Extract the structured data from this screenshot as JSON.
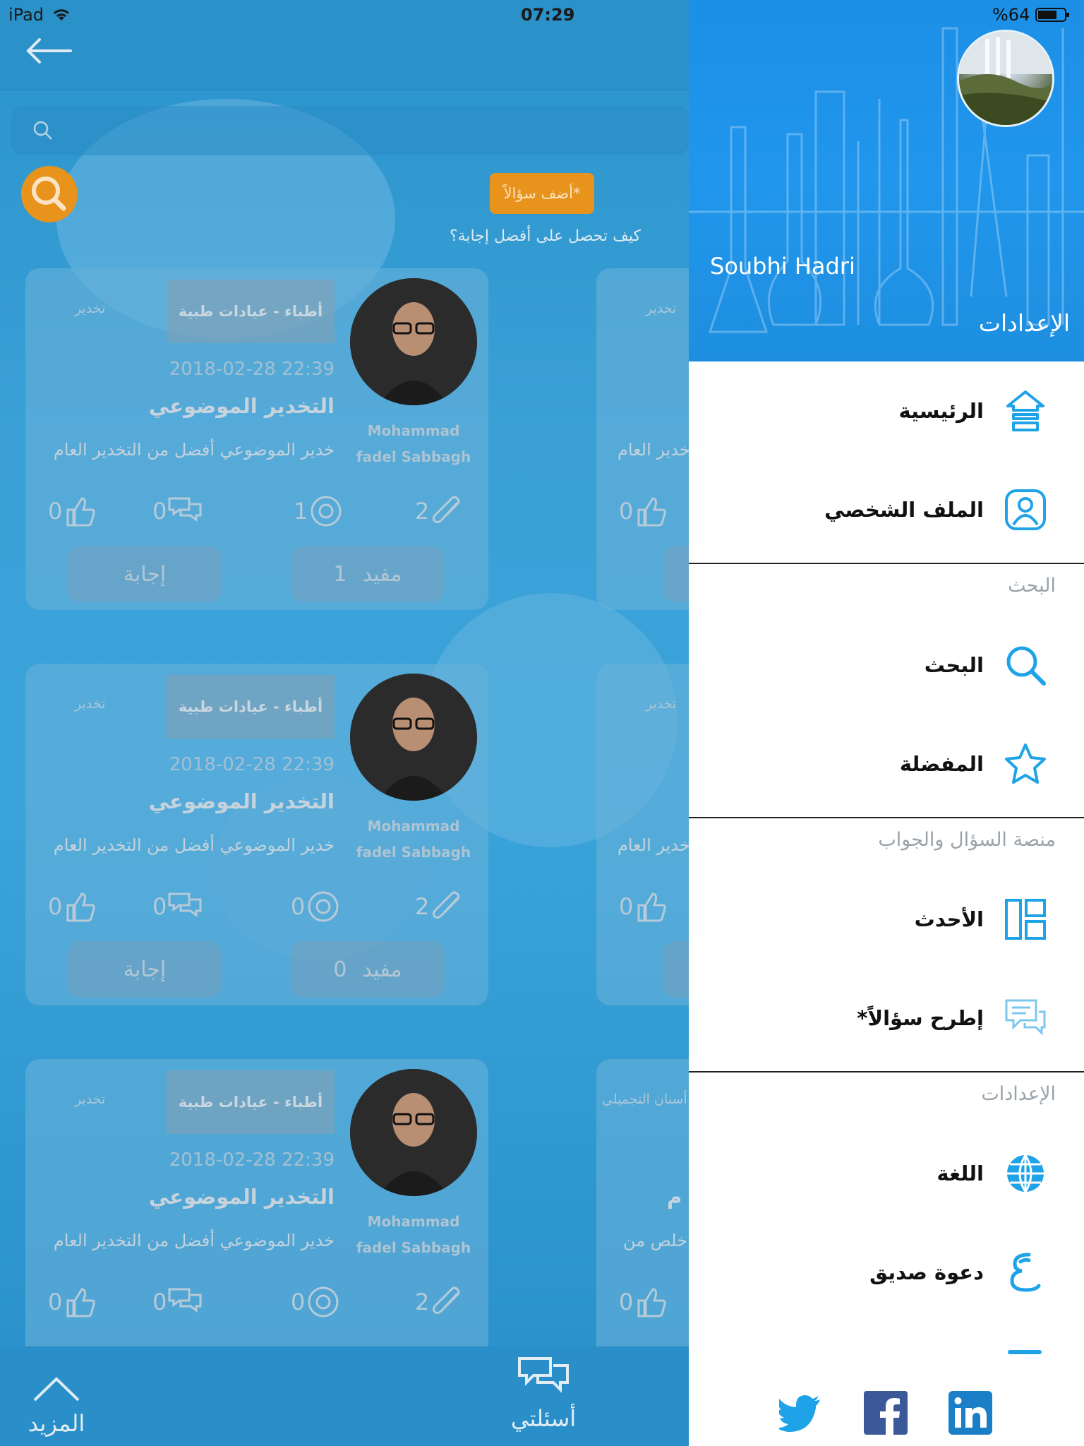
{
  "status_bar": {
    "device": "iPad",
    "time": "07:29",
    "battery": "%64"
  },
  "search": {
    "placeholder": ""
  },
  "actions": {
    "add_question": "أضف سؤالاً*",
    "how_to": "كيف تحصل على أفضل إجابة؟"
  },
  "cards": [
    {
      "tag": "أطباء - عيادات طبية",
      "category": "تخدير",
      "date": "2018-02-28 22:39",
      "title": "التخدير الموضوعي",
      "excerpt": "خدير الموضوعي أفضل من التخدير العام",
      "user_first": "Mohammad",
      "user_last": "fadel Sabbagh",
      "likes": "0",
      "comments": "0",
      "views": "1",
      "attachments": "2",
      "useful_label": "مفيد",
      "useful_count": "1",
      "answer_label": "إجابة"
    },
    {
      "tag": "أطباء - عيادات طبية",
      "category": "تخدير",
      "date": "2018-02-28 22:39",
      "title": "التخدير الموضوعي",
      "excerpt": "خدير الموضوعي أفضل من التخدير العام",
      "user_first": "Mohammad",
      "user_last": "fadel Sabbagh",
      "likes": "0",
      "comments": "0",
      "views": "0",
      "attachments": "2",
      "useful_label": "مفيد",
      "useful_count": "0",
      "answer_label": "إجابة"
    },
    {
      "tag": "أطباء - عيادات طبية",
      "category": "تخدير",
      "date": "2018-02-28 22:39",
      "title": "التخدير الموضوعي",
      "excerpt": "خدير الموضوعي أفضل من التخدير العام",
      "user_first": "Mohammad",
      "user_last": "fadel Sabbagh",
      "likes": "0",
      "comments": "0",
      "views": "0",
      "attachments": "2"
    }
  ],
  "partial_cards": [
    {
      "category": "تخدير",
      "excerpt": "خدير العام",
      "likes": "0"
    },
    {
      "category": "تخدير",
      "excerpt": "خدير العام",
      "likes": "0"
    },
    {
      "category": "أسنان التجميلي",
      "title": "م",
      "excerpt": "خلص من",
      "likes": "0"
    }
  ],
  "bottom_tabs": {
    "more": "المزيد",
    "my_questions": "أسئلتي"
  },
  "drawer": {
    "user_name": "Soubhi Hadri",
    "hero_title": "الإعدادات",
    "items": {
      "home": "الرئيسية",
      "profile": "الملف الشخصي",
      "search": "البحث",
      "favorites": "المفضلة",
      "latest": "الأحدث",
      "ask": "*إطرح سؤالاً",
      "language": "اللغة",
      "invite": "دعوة صديق"
    },
    "sections": {
      "search": "البحث",
      "qa_platform": "منصة السؤال والجواب",
      "settings": "الإعدادات"
    }
  },
  "social": [
    "twitter-icon",
    "facebook-icon",
    "linkedin-icon"
  ],
  "colors": {
    "accent_orange": "#e8941c",
    "drawer_blue": "#1e90e6",
    "icon_blue": "#1ea3e8"
  }
}
